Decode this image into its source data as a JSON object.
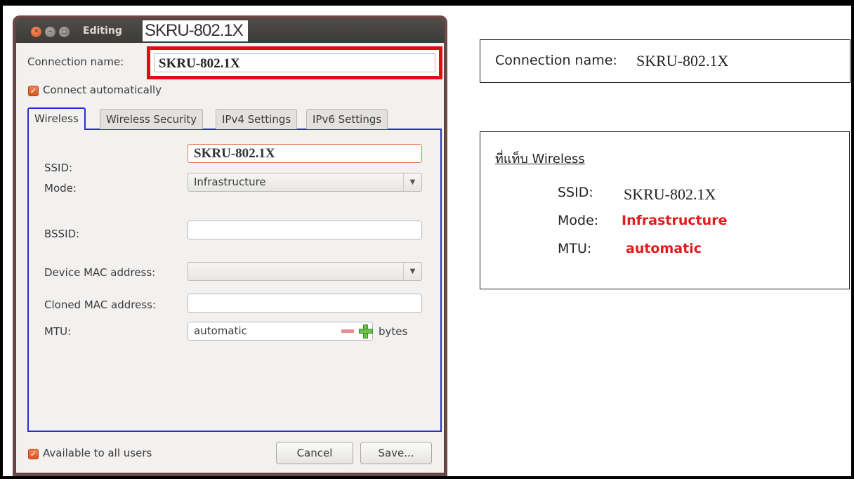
{
  "dialog": {
    "title_prefix": "Editing",
    "title_name": "SKRU-802.1X",
    "connection_name_label": "Connection name:",
    "connection_name_value": "SKRU-802.1X",
    "connect_automatically_label": "Connect automatically",
    "connect_automatically_checked": true,
    "tabs": [
      {
        "label": "Wireless",
        "active": true
      },
      {
        "label": "Wireless Security",
        "active": false
      },
      {
        "label": "IPv4 Settings",
        "active": false
      },
      {
        "label": "IPv6 Settings",
        "active": false
      }
    ],
    "wireless": {
      "ssid_label": "SSID:",
      "ssid_value": "SKRU-802.1X",
      "mode_label": "Mode:",
      "mode_value": "Infrastructure",
      "bssid_label": "BSSID:",
      "bssid_value": "",
      "device_mac_label": "Device MAC address:",
      "device_mac_value": "",
      "cloned_mac_label": "Cloned MAC address:",
      "cloned_mac_value": "",
      "mtu_label": "MTU:",
      "mtu_value": "automatic",
      "mtu_unit": "bytes"
    },
    "available_all_users_label": "Available to all users",
    "available_all_users_checked": true,
    "cancel_label": "Cancel",
    "save_label": "Save..."
  },
  "info_connection": {
    "label": "Connection name:",
    "value": "SKRU-802.1X"
  },
  "info_wireless": {
    "title": "ที่แท็บ Wireless",
    "ssid_label": "SSID:",
    "ssid_value": "SKRU-802.1X",
    "mode_label": "Mode:",
    "mode_value": "Infrastructure",
    "mtu_label": "MTU:",
    "mtu_value": "automatic"
  },
  "colors": {
    "highlight_red": "#e20b16",
    "highlight_blue": "#2b2be0",
    "accent_orange": "#dd4814",
    "value_red": "#e31b1b"
  }
}
